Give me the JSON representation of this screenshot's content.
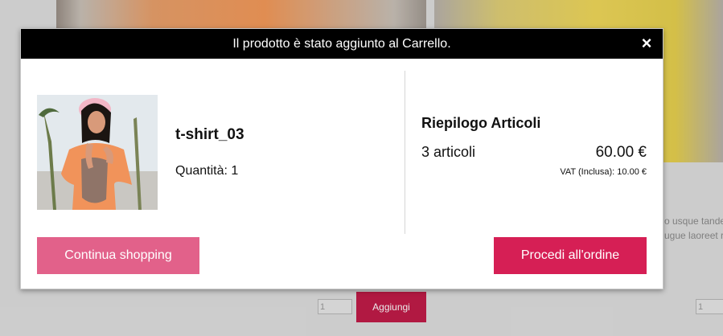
{
  "background": {
    "text_line1": "o usque tande",
    "text_line2": "ugue laoreet ru",
    "qty_left": "1",
    "qty_right": "1",
    "add_button": "Aggiungi"
  },
  "modal": {
    "header": "Il prodotto è stato aggiunto al Carrello.",
    "close_icon": "×",
    "product": {
      "name": "t-shirt_03",
      "quantity": "Quantità: 1"
    },
    "summary": {
      "title": "Riepilogo Articoli",
      "count": "3 articoli",
      "total": "60.00 €",
      "vat": "VAT (Inclusa): 10.00 €"
    },
    "buttons": {
      "continue": "Continua shopping",
      "checkout": "Procedi all'ordine"
    }
  },
  "colors": {
    "header_bg": "#000000",
    "continue_btn": "#e2618a",
    "checkout_btn": "#d61f55",
    "add_btn": "#c01c48"
  }
}
